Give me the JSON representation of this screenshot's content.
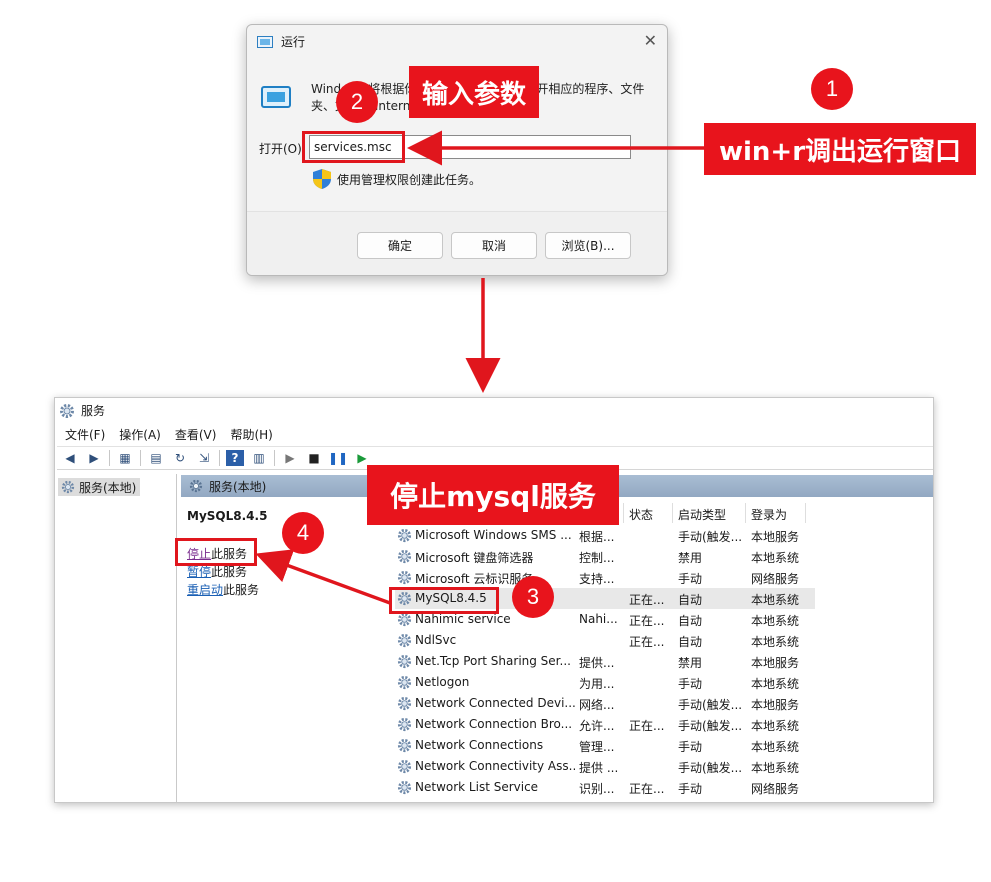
{
  "run_dialog": {
    "title": "运行",
    "description": "Windows 将根据你所输入的名称，为你打开相应的程序、文件夹、文档或 Internet 资源。",
    "open_label": "打开(O):",
    "input_value": "services.msc",
    "admin_note": "使用管理权限创建此任务。",
    "ok_label": "确定",
    "cancel_label": "取消",
    "browse_label": "浏览(B)..."
  },
  "annotations": {
    "step1_number": "1",
    "step1_label": "win+r调出运行窗口",
    "step2_number": "2",
    "step2_label": "输入参数",
    "step3_number": "3",
    "step4_number": "4",
    "step_stop_label": "停止mysql服务"
  },
  "services_window": {
    "title": "服务",
    "menu": [
      "文件(F)",
      "操作(A)",
      "查看(V)",
      "帮助(H)"
    ],
    "tree_item": "服务(本地)",
    "main_header": "服务(本地)",
    "selected_service": "MySQL8.4.5",
    "actions": [
      {
        "link": "停止",
        "rest": "此服务"
      },
      {
        "link": "暂停",
        "rest": "此服务"
      },
      {
        "link": "重启动",
        "rest": "此服务"
      }
    ],
    "columns": {
      "status": "状态",
      "startup": "启动类型",
      "logon": "登录为"
    },
    "rows": [
      {
        "name": "Microsoft Windows SMS ...",
        "desc": "根据...",
        "status": "",
        "startup": "手动(触发...",
        "logon": "本地服务"
      },
      {
        "name": "Microsoft 键盘筛选器",
        "desc": "控制...",
        "status": "",
        "startup": "禁用",
        "logon": "本地系统"
      },
      {
        "name": "Microsoft 云标识服务",
        "desc": "支持...",
        "status": "",
        "startup": "手动",
        "logon": "网络服务"
      },
      {
        "name": "MySQL8.4.5",
        "desc": "",
        "status": "正在...",
        "startup": "自动",
        "logon": "本地系统"
      },
      {
        "name": "Nahimic service",
        "desc": "Nahi...",
        "status": "正在...",
        "startup": "自动",
        "logon": "本地系统"
      },
      {
        "name": "NdlSvc",
        "desc": "",
        "status": "正在...",
        "startup": "自动",
        "logon": "本地系统"
      },
      {
        "name": "Net.Tcp Port Sharing Ser...",
        "desc": "提供...",
        "status": "",
        "startup": "禁用",
        "logon": "本地服务"
      },
      {
        "name": "Netlogon",
        "desc": "为用...",
        "status": "",
        "startup": "手动",
        "logon": "本地系统"
      },
      {
        "name": "Network Connected Devi...",
        "desc": "网络...",
        "status": "",
        "startup": "手动(触发...",
        "logon": "本地服务"
      },
      {
        "name": "Network Connection Bro...",
        "desc": "允许...",
        "status": "正在...",
        "startup": "手动(触发...",
        "logon": "本地系统"
      },
      {
        "name": "Network Connections",
        "desc": "管理...",
        "status": "",
        "startup": "手动",
        "logon": "本地系统"
      },
      {
        "name": "Network Connectivity Ass...",
        "desc": "提供 ...",
        "status": "",
        "startup": "手动(触发...",
        "logon": "本地系统"
      },
      {
        "name": "Network List Service",
        "desc": "识别...",
        "status": "正在...",
        "startup": "手动",
        "logon": "网络服务"
      }
    ]
  }
}
